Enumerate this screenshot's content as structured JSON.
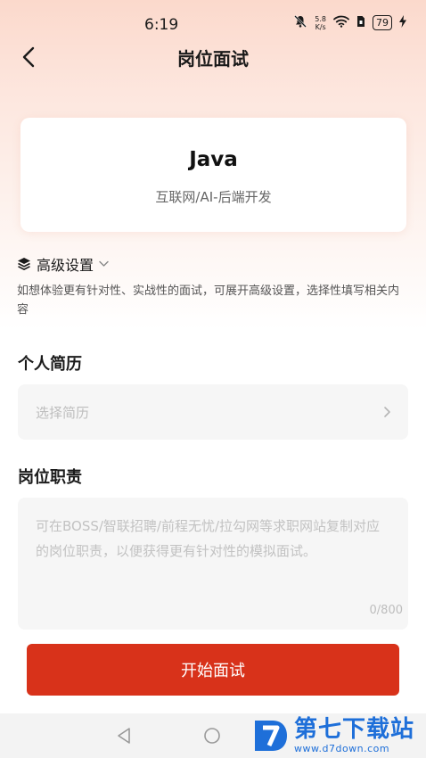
{
  "status_bar": {
    "time": "6:19",
    "net_speed_value": "5.8",
    "net_speed_unit": "K/s",
    "battery": "79"
  },
  "header": {
    "title": "岗位面试"
  },
  "job_card": {
    "title": "Java",
    "category": "互联网/AI-后端开发"
  },
  "advanced": {
    "label": "高级设置",
    "description": "如想体验更有针对性、实战性的面试，可展开高级设置，选择性填写相关内容"
  },
  "resume": {
    "section_title": "个人简历",
    "placeholder": "选择简历"
  },
  "duty": {
    "section_title": "岗位职责",
    "placeholder": "可在BOSS/智联招聘/前程无忧/拉勾网等求职网站复制对应的岗位职责，以便获得更有针对性的模拟面试。",
    "counter": "0/800"
  },
  "actions": {
    "start_label": "开始面试"
  },
  "watermark": {
    "text_cn": "第七下载站",
    "url": "www.d7down.com"
  },
  "colors": {
    "accent": "#d8321a",
    "watermark_blue": "#1e6fd9"
  }
}
